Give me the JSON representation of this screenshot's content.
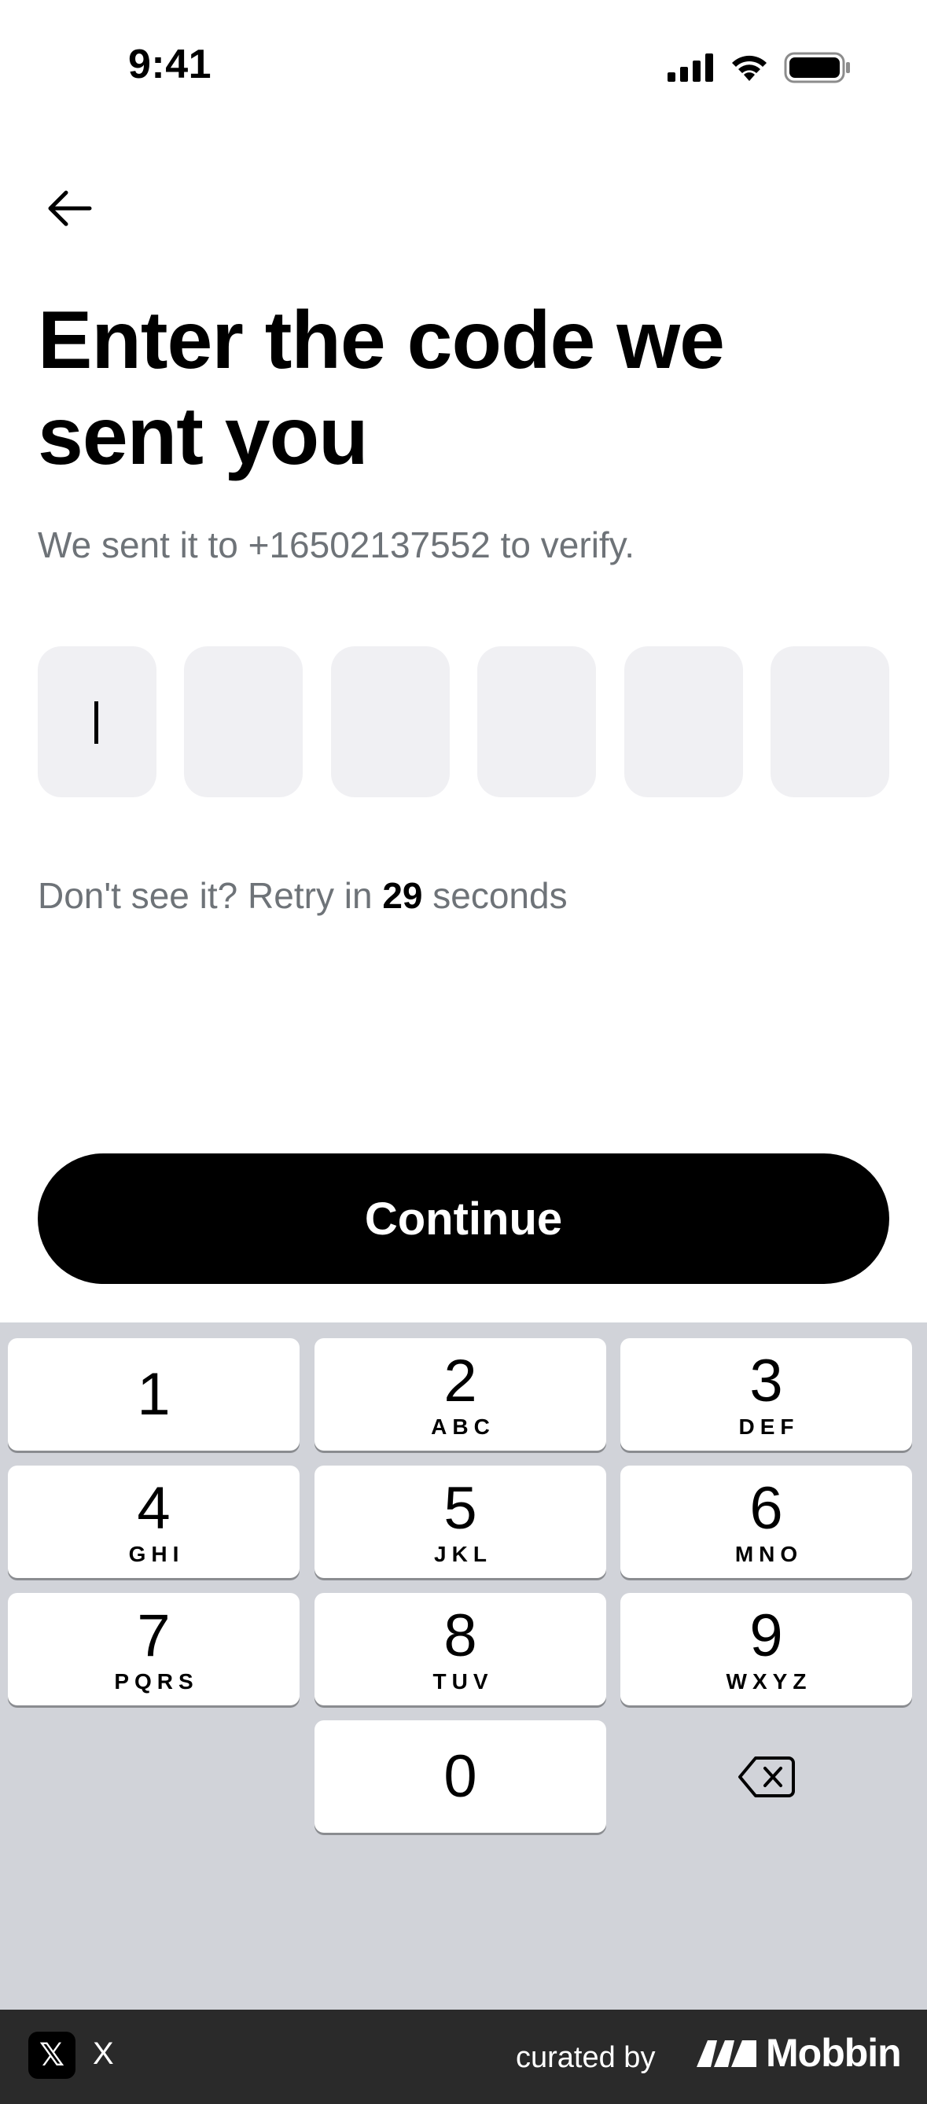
{
  "status_bar": {
    "time": "9:41"
  },
  "header": {
    "title": "Enter the code we sent you",
    "subtitle": "We sent it to +16502137552 to verify."
  },
  "code_input": {
    "length": 6,
    "filled": 0
  },
  "retry": {
    "prefix": "Don't see it? Retry in",
    "seconds": "29",
    "suffix": "seconds"
  },
  "continue_label": "Continue",
  "keypad": {
    "keys": [
      {
        "num": "1",
        "letters": ""
      },
      {
        "num": "2",
        "letters": "ABC"
      },
      {
        "num": "3",
        "letters": "DEF"
      },
      {
        "num": "4",
        "letters": "GHI"
      },
      {
        "num": "5",
        "letters": "JKL"
      },
      {
        "num": "6",
        "letters": "MNO"
      },
      {
        "num": "7",
        "letters": "PQRS"
      },
      {
        "num": "8",
        "letters": "TUV"
      },
      {
        "num": "9",
        "letters": "WXYZ"
      },
      {
        "num": "0",
        "letters": ""
      }
    ]
  },
  "footer": {
    "app_name": "X",
    "logo_glyph": "𝕏",
    "curated_by": "curated by",
    "brand": "Mobbin"
  }
}
